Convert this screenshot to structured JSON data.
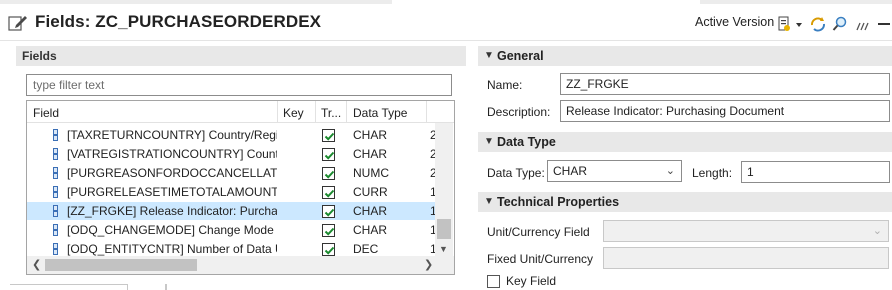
{
  "editor": {
    "title": "Fields: ZC_PURCHASEORDERDEX",
    "active_version": "Active Version",
    "toolbar_icons": [
      "activate-icon",
      "dropdown-icon",
      "refresh-icon",
      "find-icon",
      "more-icon",
      "minimize-icon"
    ]
  },
  "left": {
    "section_title": "Fields",
    "filter_placeholder": "type filter text",
    "columns": [
      "Field",
      "Key",
      "Tr...",
      "Data Type"
    ],
    "rows": [
      {
        "field": "[TAXRETURNCOUNTRY] Country/Regior",
        "key": "",
        "transient": true,
        "type": "CHAR",
        "extra": "2"
      },
      {
        "field": "[VATREGISTRATIONCOUNTRY] Country/",
        "key": "",
        "transient": true,
        "type": "CHAR",
        "extra": "2"
      },
      {
        "field": "[PURGREASONFORDOCCANCELLATION",
        "key": "",
        "transient": true,
        "type": "NUMC",
        "extra": "2"
      },
      {
        "field": "[PURGRELEASETIMETOTALAMOUNT] To",
        "key": "",
        "transient": true,
        "type": "CURR",
        "extra": "1"
      },
      {
        "field": "[ZZ_FRGKE] Release Indicator: Purchasir",
        "key": "",
        "transient": true,
        "type": "CHAR",
        "extra": "1"
      },
      {
        "field": "[ODQ_CHANGEMODE] Change Mode fc",
        "key": "",
        "transient": true,
        "type": "CHAR",
        "extra": "1"
      },
      {
        "field": "[ODQ_ENTITYCNTR] Number of Data Ur",
        "key": "",
        "transient": true,
        "type": "DEC",
        "extra": "1"
      }
    ],
    "selected_row": 4
  },
  "general": {
    "section_title": "General",
    "name_label": "Name:",
    "name_value": "ZZ_FRGKE",
    "description_label": "Description:",
    "description_value": "Release Indicator: Purchasing Document"
  },
  "data_type": {
    "section_title": "Data Type",
    "type_label": "Data Type:",
    "type_value": "CHAR",
    "length_label": "Length:",
    "length_value": "1"
  },
  "technical": {
    "section_title": "Technical Properties",
    "unit_currency_label": "Unit/Currency Field",
    "unit_currency_value": "",
    "fixed_unit_label": "Fixed Unit/Currency",
    "fixed_unit_value": "",
    "key_field_label": "Key Field"
  }
}
